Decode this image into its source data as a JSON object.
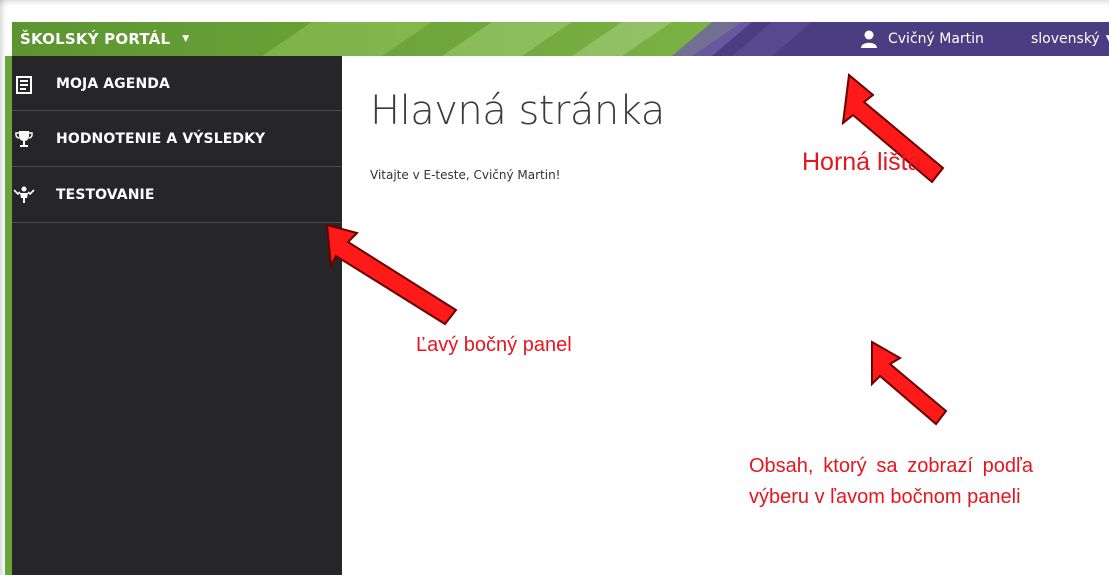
{
  "topbar": {
    "brand": "ŠKOLSKÝ PORTÁL",
    "user": "Cvičný Martin",
    "language": "slovenský"
  },
  "sidebar": {
    "items": [
      {
        "label": "MOJA AGENDA",
        "icon": "agenda-icon"
      },
      {
        "label": "HODNOTENIE A VÝSLEDKY",
        "icon": "trophy-icon"
      },
      {
        "label": "TESTOVANIE",
        "icon": "testing-icon"
      }
    ]
  },
  "main": {
    "title": "Hlavná stránka",
    "welcome": "Vitajte v E-teste, Cvičný Martin!"
  },
  "annotations": {
    "topbar": "Horná lišta",
    "sidebar": "Ľavý bočný panel",
    "content": "Obsah, ktorý sa zobrazí podľa výberu v ľavom bočnom paneli"
  },
  "colors": {
    "topbar_green": "#6aa33a",
    "topbar_purple": "#4b3d82",
    "sidebar_bg": "#262629",
    "annotation_red": "#e8141e"
  }
}
